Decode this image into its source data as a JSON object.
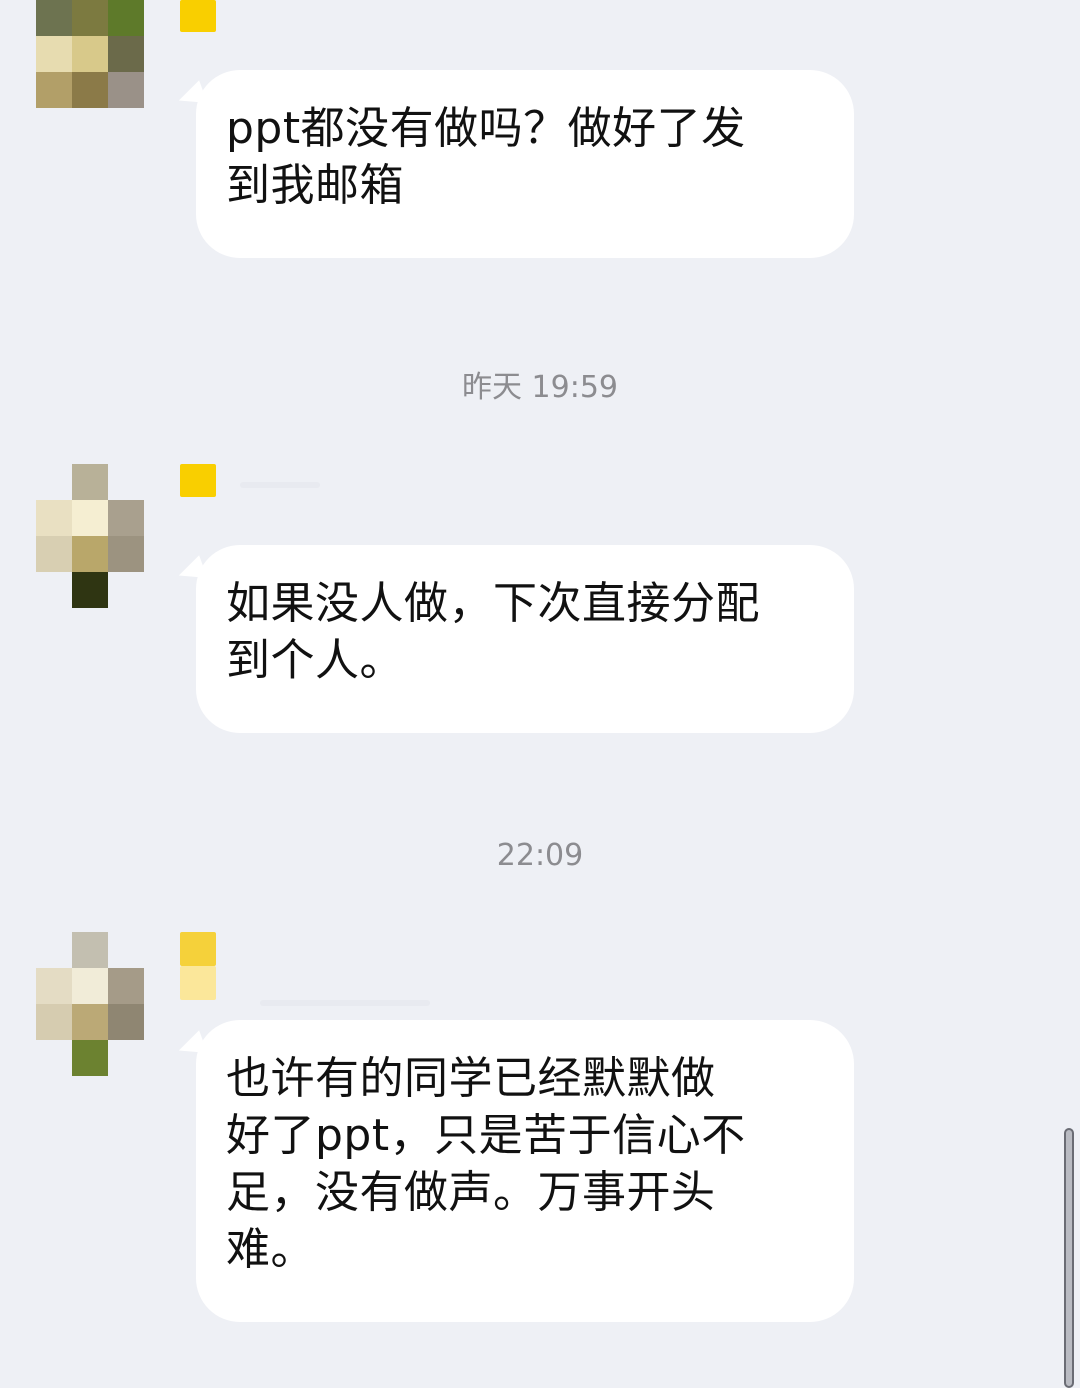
{
  "messages": [
    {
      "avatar_icon": "blurred-avatar-icon",
      "text": "ppt都没有做吗？做好了发\n到我邮箱"
    },
    {
      "avatar_icon": "blurred-avatar-icon",
      "text": "如果没人做，下次直接分配\n到个人。"
    },
    {
      "avatar_icon": "blurred-avatar-icon",
      "text": "也许有的同学已经默默做\n好了ppt，只是苦于信心不\n足，没有做声。万事开头\n难。"
    }
  ],
  "timestamps": [
    "昨天 19:59",
    "22:09"
  ],
  "colors": {
    "background": "#eef0f5",
    "bubble": "#ffffff",
    "tag": "#f9cf00",
    "timestamp": "#8c8c90"
  }
}
